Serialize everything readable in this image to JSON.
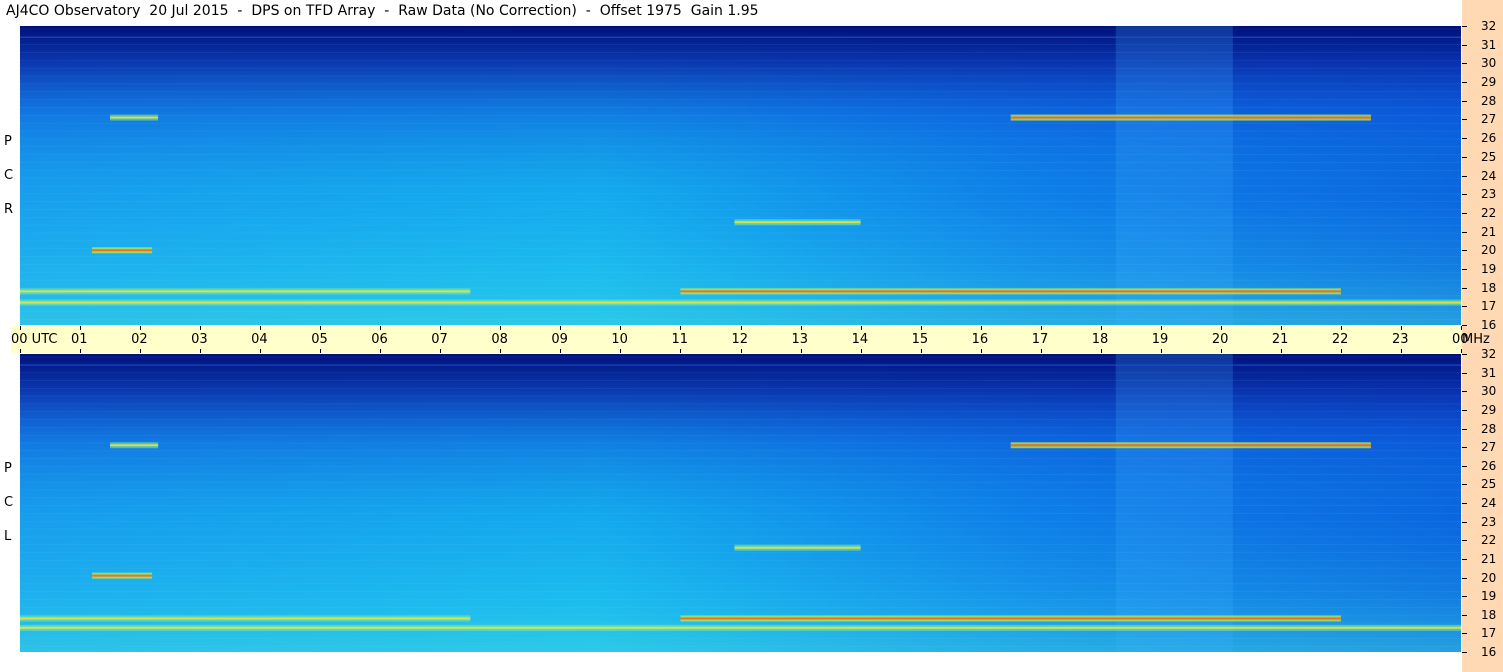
{
  "title": "AJ4CO Observatory  20 Jul 2015  -  DPS on TFD Array  -  Raw Data (No Correction)  -  Offset 1975  Gain 1.95",
  "chart_data": {
    "type": "heatmap",
    "title": "AJ4CO Observatory  20 Jul 2015  -  DPS on TFD Array  -  Raw Data (No Correction)  -  Offset 1975  Gain 1.95",
    "x_axis": {
      "label_start": "00 UTC",
      "labels": [
        "00 UTC",
        "01",
        "02",
        "03",
        "04",
        "05",
        "06",
        "07",
        "08",
        "09",
        "10",
        "11",
        "12",
        "13",
        "14",
        "15",
        "16",
        "17",
        "18",
        "19",
        "20",
        "21",
        "22",
        "23",
        "00"
      ],
      "range_hours": [
        0,
        24
      ]
    },
    "y_axis": {
      "unit": "MHz",
      "ticks": [
        "32",
        "31",
        "30",
        "29",
        "28",
        "27",
        "26",
        "25",
        "24",
        "23",
        "22",
        "21",
        "20",
        "19",
        "18",
        "17",
        "16"
      ],
      "range_mhz": [
        16,
        32
      ]
    },
    "panels": [
      {
        "name": "RCP",
        "letters": [
          "R",
          "C",
          "P"
        ],
        "bands": [
          {
            "mhz": 27.1,
            "start_h": 16.5,
            "end_h": 22.5,
            "intensity": "high"
          },
          {
            "mhz": 27.1,
            "start_h": 1.5,
            "end_h": 2.3,
            "intensity": "medium"
          },
          {
            "mhz": 17.8,
            "start_h": 11.0,
            "end_h": 22.0,
            "intensity": "high"
          },
          {
            "mhz": 17.8,
            "start_h": 0.0,
            "end_h": 7.5,
            "intensity": "medium"
          },
          {
            "mhz": 17.2,
            "start_h": 0.0,
            "end_h": 24.0,
            "intensity": "medium"
          },
          {
            "mhz": 20.0,
            "start_h": 1.2,
            "end_h": 2.2,
            "intensity": "high"
          },
          {
            "mhz": 21.5,
            "start_h": 11.9,
            "end_h": 14.0,
            "intensity": "medium"
          }
        ]
      },
      {
        "name": "LCP",
        "letters": [
          "L",
          "C",
          "P"
        ],
        "bands": [
          {
            "mhz": 27.1,
            "start_h": 16.5,
            "end_h": 22.5,
            "intensity": "high"
          },
          {
            "mhz": 27.1,
            "start_h": 1.5,
            "end_h": 2.3,
            "intensity": "medium"
          },
          {
            "mhz": 17.8,
            "start_h": 11.0,
            "end_h": 22.0,
            "intensity": "high"
          },
          {
            "mhz": 17.8,
            "start_h": 0.0,
            "end_h": 7.5,
            "intensity": "medium"
          },
          {
            "mhz": 17.3,
            "start_h": 0.0,
            "end_h": 24.0,
            "intensity": "medium"
          },
          {
            "mhz": 20.1,
            "start_h": 1.2,
            "end_h": 2.2,
            "intensity": "high"
          },
          {
            "mhz": 21.6,
            "start_h": 11.9,
            "end_h": 14.0,
            "intensity": "medium"
          }
        ]
      }
    ],
    "colors": {
      "background_low": "#00107a",
      "background_mid": "#0b6df0",
      "background_high": "#2fd6f2",
      "strip_utc": "#ffffcc",
      "strip_freq": "#ffd9b3"
    }
  }
}
